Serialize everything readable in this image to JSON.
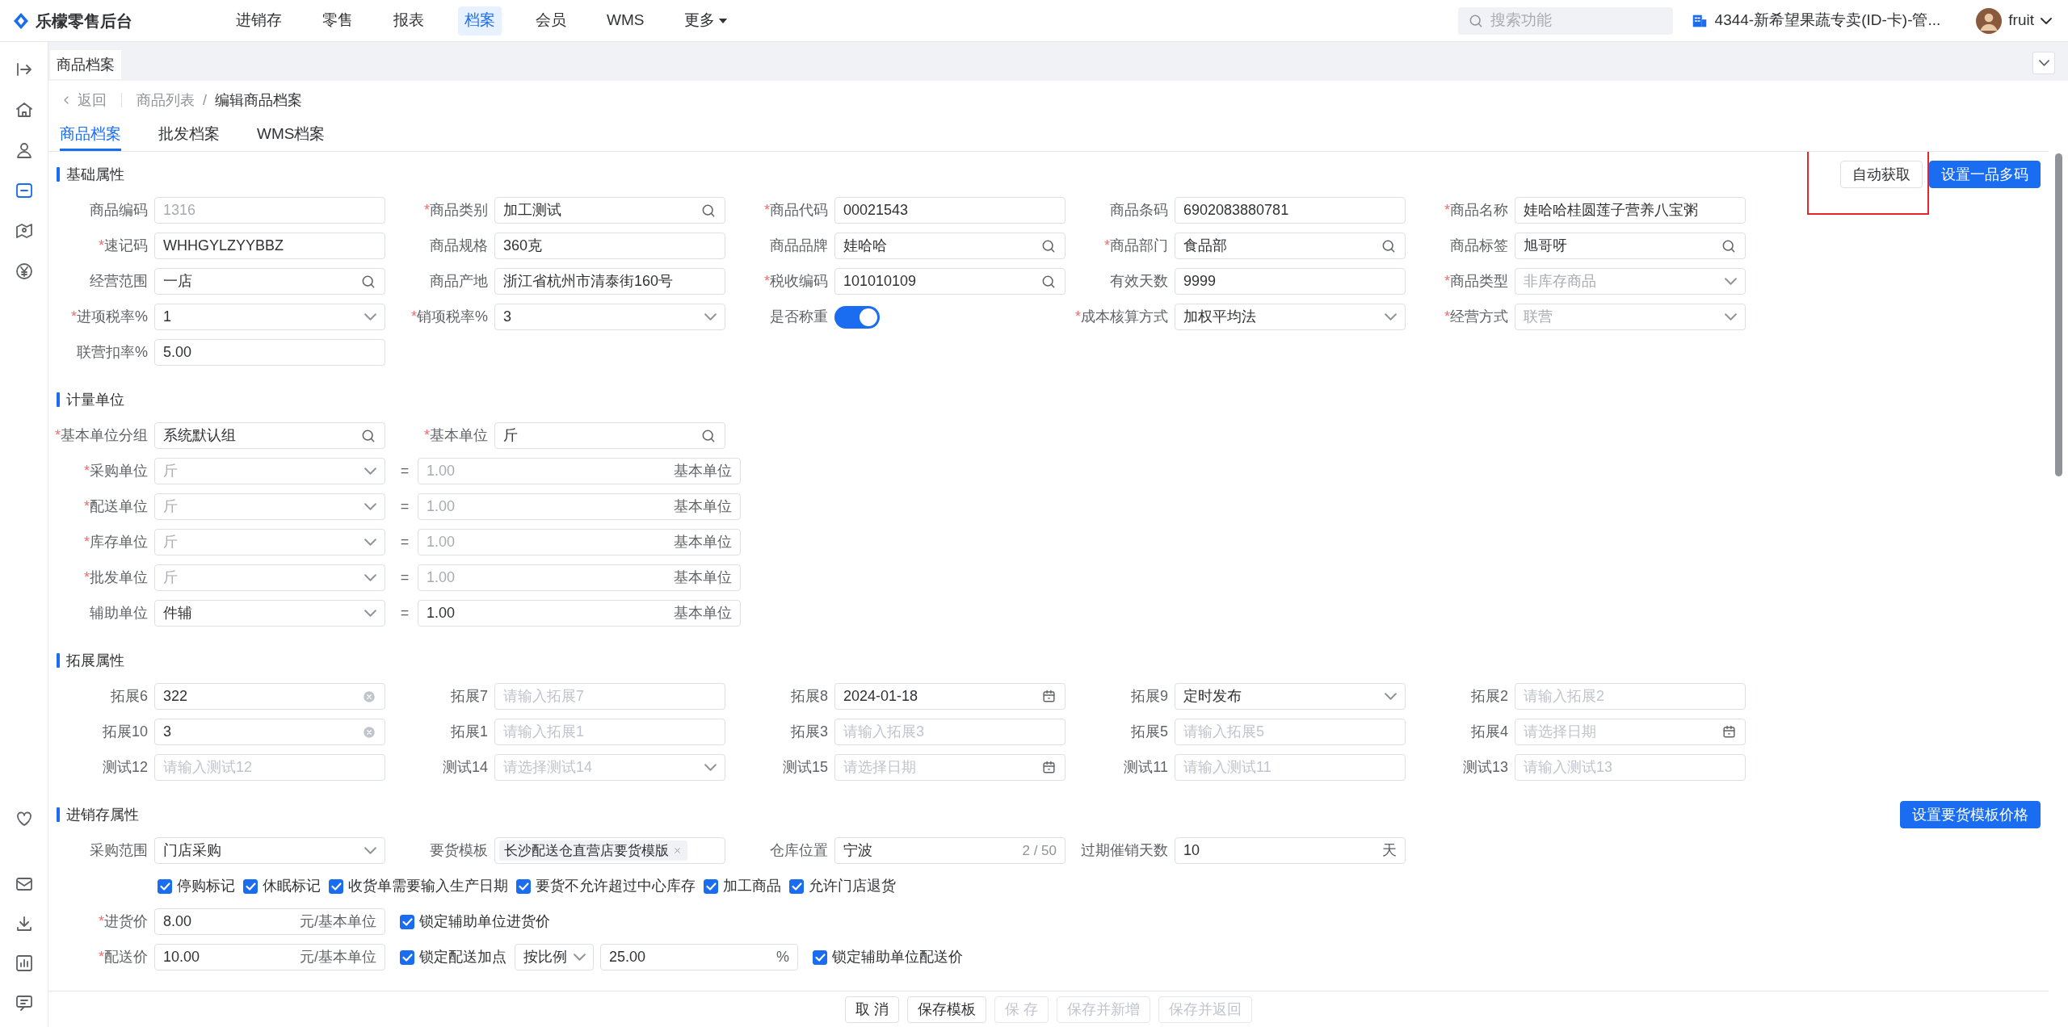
{
  "app": {
    "title": "乐檬零售后台"
  },
  "nav_items": [
    {
      "label": "进销存",
      "selected": false
    },
    {
      "label": "零售",
      "selected": false
    },
    {
      "label": "报表",
      "selected": false
    },
    {
      "label": "档案",
      "selected": true
    },
    {
      "label": "会员",
      "selected": false
    },
    {
      "label": "WMS",
      "selected": false
    },
    {
      "label": "更多",
      "selected": false,
      "has_menu": true
    }
  ],
  "search": {
    "placeholder": "搜索功能"
  },
  "store": {
    "label": "4344-新希望果蔬专卖(ID-卡)-管..."
  },
  "user": {
    "name": "fruit"
  },
  "sidebar": {
    "top_items": [
      {
        "selected": false
      },
      {
        "selected": false
      },
      {
        "selected": false
      },
      {
        "selected": true
      },
      {
        "selected": false
      },
      {
        "selected": false
      }
    ],
    "bottom_items": [
      {
        "selected": false
      },
      {
        "selected": false
      },
      {
        "selected": false
      },
      {
        "selected": false
      },
      {
        "selected": false
      }
    ]
  },
  "page_tabs": [
    {
      "label": "商品档案",
      "selected": true
    }
  ],
  "breadcrumb": {
    "back": "返回",
    "separator": "/",
    "items": [
      "商品列表",
      "编辑商品档案"
    ]
  },
  "sub_tabs": [
    {
      "label": "商品档案",
      "selected": true
    },
    {
      "label": "批发档案",
      "selected": false
    },
    {
      "label": "WMS档案",
      "selected": false
    }
  ],
  "sections": [
    {
      "title": "基础属性",
      "actions": [
        {
          "label": "自动获取",
          "kind": "default",
          "highlighted": true
        },
        {
          "label": "设置一品多码",
          "kind": "primary"
        }
      ],
      "rows": [
        [
          {
            "label": "商品编码",
            "kind": "text",
            "value": "1316",
            "disabled": true
          },
          {
            "label": "商品类别",
            "mark": "*",
            "kind": "search",
            "value": "加工测试"
          },
          {
            "label": "商品代码",
            "mark": "*",
            "kind": "text",
            "value": "00021543"
          },
          {
            "label": "商品条码",
            "kind": "text",
            "value": "6902083880781"
          },
          {
            "label": "商品名称",
            "mark": "*",
            "kind": "text",
            "value": "娃哈哈桂圆莲子营养八宝粥"
          }
        ],
        [
          {
            "label": "速记码",
            "mark": "*",
            "kind": "text",
            "value": "WHHGYLZYYBBZ"
          },
          {
            "label": "商品规格",
            "kind": "text",
            "value": "360克"
          },
          {
            "label": "商品品牌",
            "kind": "search",
            "value": "娃哈哈"
          },
          {
            "label": "商品部门",
            "mark": "*",
            "kind": "search",
            "value": "食品部"
          },
          {
            "label": "商品标签",
            "kind": "search",
            "value": "旭哥呀"
          }
        ],
        [
          {
            "label": "经营范围",
            "kind": "search",
            "value": "一店"
          },
          {
            "label": "商品产地",
            "kind": "text",
            "value": "浙江省杭州市清泰街160号"
          },
          {
            "label": "税收编码",
            "mark": "*",
            "kind": "search",
            "value": "101010109"
          },
          {
            "label": "有效天数",
            "kind": "text",
            "value": "9999"
          },
          {
            "label": "商品类型",
            "mark": "*",
            "kind": "select",
            "value": "非库存商品",
            "disabled": true
          }
        ],
        [
          {
            "label": "进项税率%",
            "mark": "*",
            "kind": "select",
            "value": "1"
          },
          {
            "label": "销项税率%",
            "mark": "*",
            "kind": "select",
            "value": "3"
          },
          {
            "label": "是否称重",
            "kind": "switch",
            "on": true
          },
          {
            "label": "成本核算方式",
            "mark": "*",
            "kind": "select",
            "value": "加权平均法"
          },
          {
            "label": "经营方式",
            "mark": "*",
            "kind": "select",
            "value": "联营",
            "disabled": true
          }
        ],
        [
          {
            "label": "联营扣率%",
            "kind": "text",
            "value": "5.00"
          }
        ]
      ]
    },
    {
      "title": "计量单位",
      "fields": [
        {
          "label": "基本单位分组",
          "mark": "*",
          "kind": "search",
          "value": "系统默认组"
        },
        {
          "label": "基本单位",
          "mark": "*",
          "kind": "search",
          "value": "斤"
        }
      ],
      "conversions": [
        {
          "unit": {
            "label": "采购单位",
            "mark": "*",
            "kind": "select",
            "value": "斤",
            "disabled": true
          },
          "equals": "=",
          "ratio": {
            "kind": "ratio",
            "value": "1.00",
            "suffix": "基本单位",
            "disabled": true
          }
        },
        {
          "unit": {
            "label": "配送单位",
            "mark": "*",
            "kind": "select",
            "value": "斤",
            "disabled": true
          },
          "equals": "=",
          "ratio": {
            "kind": "ratio",
            "value": "1.00",
            "suffix": "基本单位",
            "disabled": true
          }
        },
        {
          "unit": {
            "label": "库存单位",
            "mark": "*",
            "kind": "select",
            "value": "斤",
            "disabled": true
          },
          "equals": "=",
          "ratio": {
            "kind": "ratio",
            "value": "1.00",
            "suffix": "基本单位",
            "disabled": true
          }
        },
        {
          "unit": {
            "label": "批发单位",
            "mark": "*",
            "kind": "select",
            "value": "斤",
            "disabled": true
          },
          "equals": "=",
          "ratio": {
            "kind": "ratio",
            "value": "1.00",
            "suffix": "基本单位",
            "disabled": true
          }
        },
        {
          "unit": {
            "label": "辅助单位",
            "kind": "select",
            "value": "件辅",
            "disabled": false
          },
          "equals": "=",
          "ratio": {
            "kind": "ratio",
            "value": "1.00",
            "suffix": "基本单位",
            "disabled": false
          }
        }
      ]
    },
    {
      "title": "拓展属性",
      "rows": [
        [
          {
            "label": "拓展6",
            "kind": "clearable",
            "value": "322"
          },
          {
            "label": "拓展7",
            "kind": "text",
            "placeholder": "请输入拓展7"
          },
          {
            "label": "拓展8",
            "kind": "date",
            "value": "2024-01-18"
          },
          {
            "label": "拓展9",
            "kind": "select",
            "value": "定时发布"
          },
          {
            "label": "拓展2",
            "kind": "text",
            "placeholder": "请输入拓展2"
          }
        ],
        [
          {
            "label": "拓展10",
            "kind": "clearable",
            "value": "3"
          },
          {
            "label": "拓展1",
            "kind": "text",
            "placeholder": "请输入拓展1"
          },
          {
            "label": "拓展3",
            "kind": "text",
            "placeholder": "请输入拓展3"
          },
          {
            "label": "拓展5",
            "kind": "text",
            "placeholder": "请输入拓展5"
          },
          {
            "label": "拓展4",
            "kind": "date",
            "placeholder": "请选择日期"
          }
        ],
        [
          {
            "label": "测试12",
            "kind": "text",
            "placeholder": "请输入测试12"
          },
          {
            "label": "测试14",
            "kind": "select",
            "placeholder": "请选择测试14"
          },
          {
            "label": "测试15",
            "kind": "date",
            "placeholder": "请选择日期"
          },
          {
            "label": "测试11",
            "kind": "text",
            "placeholder": "请输入测试11"
          },
          {
            "label": "测试13",
            "kind": "text",
            "placeholder": "请输入测试13"
          }
        ]
      ]
    },
    {
      "title": "进销存属性",
      "actions": [
        {
          "label": "设置要货模板价格",
          "kind": "primary"
        }
      ],
      "fields": [
        {
          "label": "采购范围",
          "kind": "select",
          "value": "门店采购"
        },
        {
          "label": "要货模板",
          "kind": "tag",
          "value": "长沙配送仓直营店要货模版"
        },
        {
          "label": "仓库位置",
          "kind": "counter",
          "value": "宁波",
          "count": "2 / 50"
        },
        {
          "label": "过期催销天数",
          "kind": "suffix",
          "value": "10",
          "suffix": "天"
        }
      ],
      "flags": [
        {
          "label": "停购标记",
          "checked": true
        },
        {
          "label": "休眠标记",
          "checked": true
        },
        {
          "label": "收货单需要输入生产日期",
          "checked": true
        },
        {
          "label": "要货不允许超过中心库存",
          "checked": true
        },
        {
          "label": "加工商品",
          "checked": true
        },
        {
          "label": "允许门店退货",
          "checked": true
        }
      ],
      "prices": [
        {
          "field": {
            "label": "进货价",
            "mark": "*",
            "kind": "suffix",
            "value": "8.00",
            "suffix": "元/基本单位"
          },
          "options": [
            {
              "kind": "checkbox",
              "label": "锁定辅助单位进货价",
              "checked": true
            }
          ]
        },
        {
          "field": {
            "label": "配送价",
            "mark": "*",
            "kind": "suffix",
            "value": "10.00",
            "suffix": "元/基本单位"
          },
          "options": [
            {
              "kind": "checkbox",
              "label": "锁定配送加点",
              "checked": true
            },
            {
              "kind": "mode",
              "value": "按比例"
            },
            {
              "kind": "percent",
              "value": "25.00",
              "suffix": "%"
            },
            {
              "kind": "checkbox",
              "label": "锁定辅助单位配送价",
              "checked": true
            }
          ]
        }
      ]
    }
  ],
  "footer_buttons": [
    {
      "label": "取 消",
      "disabled": false
    },
    {
      "label": "保存模板",
      "disabled": false
    },
    {
      "label": "保 存",
      "disabled": true
    },
    {
      "label": "保存并新增",
      "disabled": true
    },
    {
      "label": "保存并返回",
      "disabled": true
    }
  ]
}
